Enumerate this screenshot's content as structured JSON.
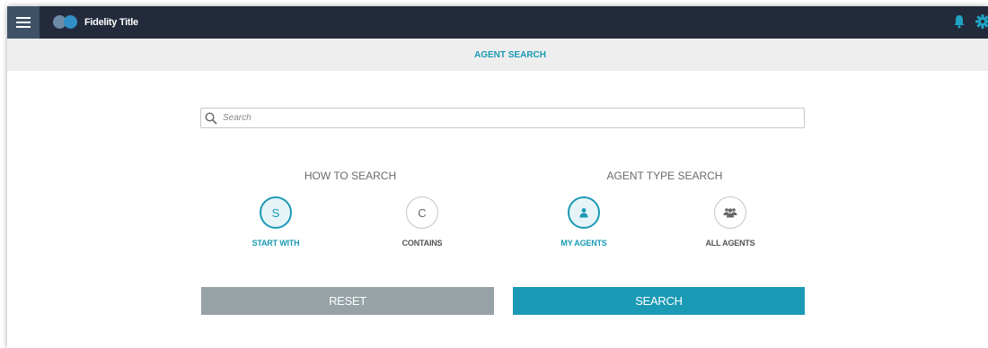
{
  "header": {
    "app_title": "Fidelity Title",
    "menu_icon": "hamburger-menu-icon",
    "toggle_icon": "toggle-icon",
    "bell_icon": "bell-icon",
    "gear_icon": "gear-icon"
  },
  "subheader": {
    "title": "AGENT SEARCH"
  },
  "search": {
    "placeholder": "Search",
    "value": "",
    "icon": "search-icon"
  },
  "how_to_search": {
    "title": "HOW TO SEARCH",
    "options": [
      {
        "glyph": "S",
        "label": "START WITH",
        "selected": true
      },
      {
        "glyph": "C",
        "label": "CONTAINS",
        "selected": false
      }
    ]
  },
  "agent_type": {
    "title": "AGENT TYPE SEARCH",
    "options": [
      {
        "icon": "person-icon",
        "label": "MY AGENTS",
        "selected": true
      },
      {
        "icon": "group-icon",
        "label": "ALL AGENTS",
        "selected": false
      }
    ]
  },
  "actions": {
    "reset_label": "RESET",
    "search_label": "SEARCH"
  },
  "colors": {
    "topbar": "#232a3b",
    "accent": "#1a9ab5",
    "reset_button": "#96a2a6",
    "subheader_bg": "#eeeeee"
  }
}
